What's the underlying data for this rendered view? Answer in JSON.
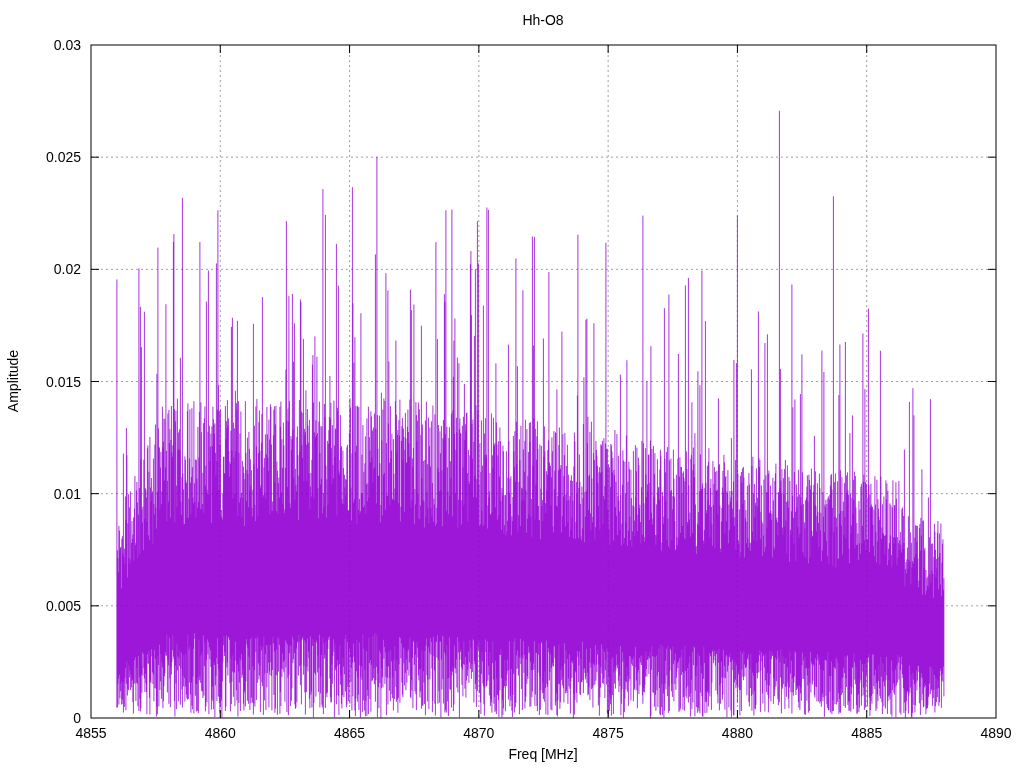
{
  "chart": {
    "title": "Hh-O8",
    "xlabel": "Freq [MHz]",
    "ylabel": "Amplitude",
    "xticks": [
      "4855",
      "4860",
      "4865",
      "4870",
      "4875",
      "4880",
      "4885",
      "4890"
    ],
    "yticks": [
      "0.03",
      "0.025",
      "0.02",
      "0.015",
      "0.01",
      "0.005",
      "0"
    ]
  }
}
